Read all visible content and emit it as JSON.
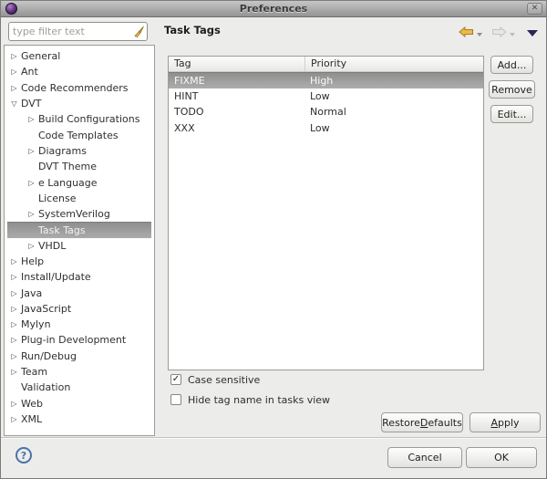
{
  "colors": {
    "selection_gray": "#8f8f8f",
    "back_arrow": "#edb84a",
    "back_arrow_border": "#a87d1e",
    "forward_arrow": "#e6e6e3",
    "forward_arrow_border": "#c3c3c0",
    "menu_triangle": "#26265a",
    "help_blue": "#4a72a8",
    "window_icon_purple": "#5c3178"
  },
  "window": {
    "title": "Preferences",
    "close_glyph": "✕"
  },
  "sidebar": {
    "filter_placeholder": "type filter text",
    "tree": [
      {
        "label": "General",
        "level": 0,
        "expander": "collapsed"
      },
      {
        "label": "Ant",
        "level": 0,
        "expander": "collapsed"
      },
      {
        "label": "Code Recommenders",
        "level": 0,
        "expander": "collapsed"
      },
      {
        "label": "DVT",
        "level": 0,
        "expander": "expanded"
      },
      {
        "label": "Build Configurations",
        "level": 1,
        "expander": "collapsed"
      },
      {
        "label": "Code Templates",
        "level": 1,
        "expander": null
      },
      {
        "label": "Diagrams",
        "level": 1,
        "expander": "collapsed"
      },
      {
        "label": "DVT Theme",
        "level": 1,
        "expander": null
      },
      {
        "label": "e Language",
        "level": 1,
        "expander": "collapsed"
      },
      {
        "label": "License",
        "level": 1,
        "expander": null
      },
      {
        "label": "SystemVerilog",
        "level": 1,
        "expander": "collapsed"
      },
      {
        "label": "Task Tags",
        "level": 1,
        "expander": null,
        "selected": true
      },
      {
        "label": "VHDL",
        "level": 1,
        "expander": "collapsed"
      },
      {
        "label": "Help",
        "level": 0,
        "expander": "collapsed"
      },
      {
        "label": "Install/Update",
        "level": 0,
        "expander": "collapsed"
      },
      {
        "label": "Java",
        "level": 0,
        "expander": "collapsed"
      },
      {
        "label": "JavaScript",
        "level": 0,
        "expander": "collapsed"
      },
      {
        "label": "Mylyn",
        "level": 0,
        "expander": "collapsed"
      },
      {
        "label": "Plug-in Development",
        "level": 0,
        "expander": "collapsed"
      },
      {
        "label": "Run/Debug",
        "level": 0,
        "expander": "collapsed"
      },
      {
        "label": "Team",
        "level": 0,
        "expander": "collapsed"
      },
      {
        "label": "Validation",
        "level": 0,
        "expander": null
      },
      {
        "label": "Web",
        "level": 0,
        "expander": "collapsed"
      },
      {
        "label": "XML",
        "level": 0,
        "expander": "collapsed"
      }
    ]
  },
  "content": {
    "title": "Task Tags",
    "table": {
      "columns": [
        "Tag",
        "Priority"
      ],
      "rows": [
        {
          "tag": "FIXME",
          "priority": "High",
          "selected": true
        },
        {
          "tag": "HINT",
          "priority": "Low",
          "selected": false
        },
        {
          "tag": "TODO",
          "priority": "Normal",
          "selected": false
        },
        {
          "tag": "XXX",
          "priority": "Low",
          "selected": false
        }
      ]
    },
    "actions": {
      "add": "Add...",
      "remove": "Remove",
      "edit": "Edit..."
    },
    "options": [
      {
        "label": "Case sensitive",
        "checked": true
      },
      {
        "label": "Hide tag name in tasks view",
        "checked": false
      }
    ],
    "restore": {
      "label": "Restore Defaults",
      "accel": "D"
    },
    "apply": {
      "label": "Apply",
      "accel": "A"
    }
  },
  "footer": {
    "help": "?",
    "cancel": "Cancel",
    "ok": "OK"
  }
}
